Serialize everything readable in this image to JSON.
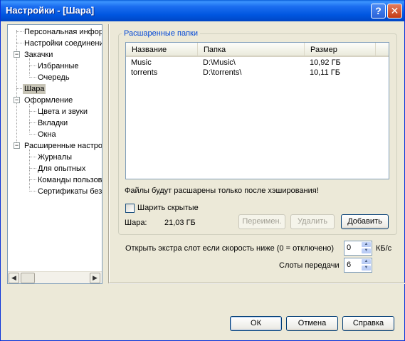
{
  "window": {
    "title": "Настройки - [Шара]"
  },
  "titlebar_buttons": {
    "help_glyph": "?",
    "close_glyph": "✕"
  },
  "tree": {
    "items": [
      {
        "label": "Персональная информация"
      },
      {
        "label": "Настройки соединения"
      },
      {
        "label": "Закачки"
      },
      {
        "label": "Избранные"
      },
      {
        "label": "Очередь"
      },
      {
        "label": "Шара"
      },
      {
        "label": "Оформление"
      },
      {
        "label": "Цвета и звуки"
      },
      {
        "label": "Вкладки"
      },
      {
        "label": "Окна"
      },
      {
        "label": "Расширенные настройки"
      },
      {
        "label": "Журналы"
      },
      {
        "label": "Для опытных"
      },
      {
        "label": "Команды пользователя"
      },
      {
        "label": "Сертификаты безопасности"
      }
    ],
    "expander_glyph": "−",
    "scroll_left": "◀",
    "scroll_right": "▶"
  },
  "share": {
    "group_title": "Расшаренные папки",
    "columns": [
      "Название",
      "Папка",
      "Размер"
    ],
    "rows": [
      {
        "name": "Music",
        "folder": "D:\\Music\\",
        "size": "10,92 ГБ"
      },
      {
        "name": "torrents",
        "folder": "D:\\torrents\\",
        "size": "10,11 ГБ"
      }
    ],
    "note": "Файлы будут расшарены только после хэширования!",
    "hidden_checkbox_label": "Шарить скрытые",
    "total_label": "Шара:",
    "total_value": "21,03 ГБ",
    "rename_button": "Переимен.",
    "delete_button": "Удалить",
    "add_button": "Добавить"
  },
  "slots": {
    "extra_slot_label": "Открыть экстра слот если скорость ниже (0 = отключено)",
    "extra_slot_value": "0",
    "extra_slot_unit": "КБ/с",
    "upload_slots_label": "Слоты передачи",
    "upload_slots_value": "6",
    "spin_up": "▲",
    "spin_down": "▼"
  },
  "footer": {
    "ok": "ОК",
    "cancel": "Отмена",
    "help": "Справка"
  }
}
